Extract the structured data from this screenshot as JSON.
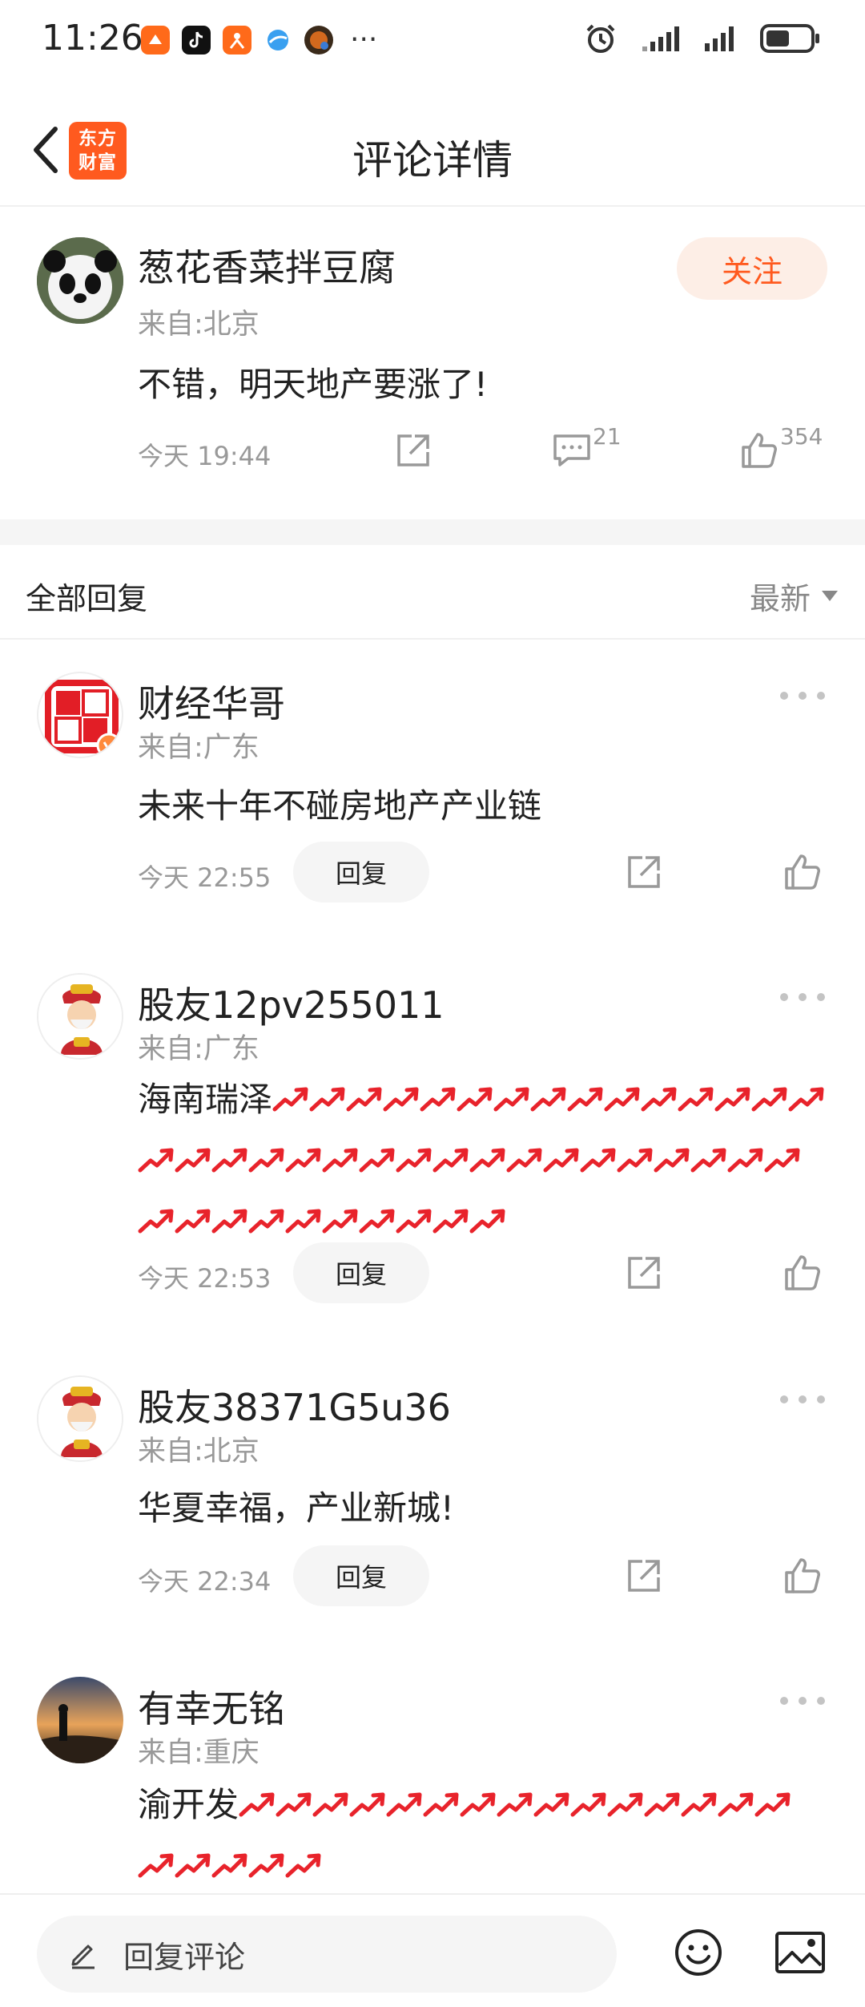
{
  "status_bar": {
    "time": "11:26",
    "dots": "···"
  },
  "header": {
    "title": "评论详情",
    "logo_line1": "东方",
    "logo_line2": "财富"
  },
  "main_comment": {
    "username": "葱花香菜拌豆腐",
    "location": "来自:北京",
    "text": "不错，明天地产要涨了!",
    "time": "今天 19:44",
    "comment_count": "21",
    "like_count": "354",
    "follow_label": "关注"
  },
  "replies_section": {
    "title": "全部回复",
    "sort_label": "最新"
  },
  "replies": [
    {
      "username": "财经华哥",
      "location": "来自:广东",
      "text": "未来十年不碰房地产产业链",
      "time": "今天 22:55",
      "reply_label": "回复"
    },
    {
      "username": "股友12pv255011",
      "location": "来自:广东",
      "text": "海南瑞泽",
      "time": "今天 22:53",
      "reply_label": "回复"
    },
    {
      "username": "股友38371G5u36",
      "location": "来自:北京",
      "text": "华夏幸福，产业新城!",
      "time": "今天 22:34",
      "reply_label": "回复"
    },
    {
      "username": "有幸无铭",
      "location": "来自:重庆",
      "text": "渝开发"
    }
  ],
  "bottom_bar": {
    "input_placeholder": "回复评论"
  },
  "colors": {
    "accent": "#ff5a1f",
    "follow_bg": "#fdeee6",
    "arrow_red": "#e8232b"
  }
}
